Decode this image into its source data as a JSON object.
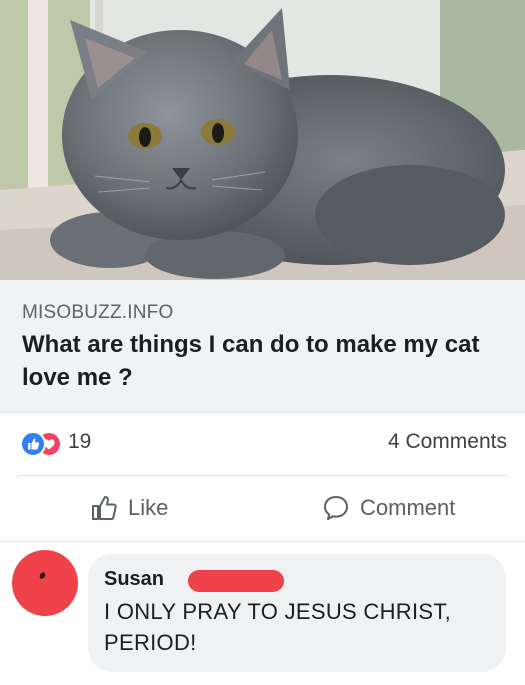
{
  "post": {
    "image_alt": "grey kitten",
    "link_domain": "MISOBUZZ.INFO",
    "link_title": "What are things I can do to make my cat love me ?",
    "reaction_count": "19",
    "comment_count": "4 Comments",
    "reaction_icons": [
      "like-icon",
      "love-icon"
    ],
    "colors": {
      "like": "#2e80f2",
      "love": "#f3425f",
      "preview_bg": "#f1f2f4"
    }
  },
  "actions": {
    "like_label": "Like",
    "comment_label": "Comment"
  },
  "comment": {
    "author": "Susan",
    "text": "I ONLY PRAY TO JESUS CHRIST, PERIOD!",
    "redaction_color": "#f0424a"
  }
}
